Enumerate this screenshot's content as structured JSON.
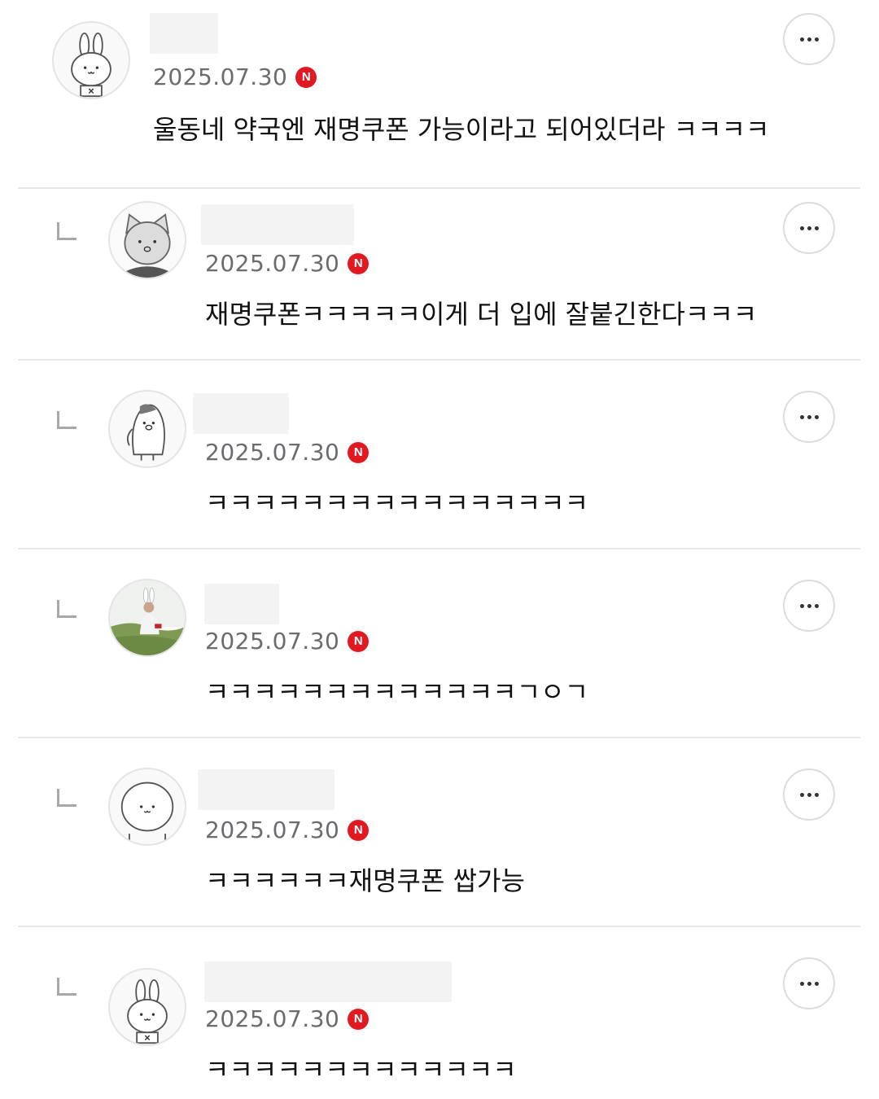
{
  "comments": [
    {
      "date": "2025.07.30",
      "badge": "N",
      "text": "울동네 약국엔 재명쿠폰 가능이라고 되어있더라 ㅋㅋㅋㅋ",
      "avatar_icon": "rabbit-avatar-icon"
    },
    {
      "date": "2025.07.30",
      "badge": "N",
      "text": "재명쿠폰ㅋㅋㅋㅋㅋ이게 더 입에 잘붙긴한다ㅋㅋㅋ",
      "avatar_icon": "cat-avatar-icon"
    },
    {
      "date": "2025.07.30",
      "badge": "N",
      "text": "ㅋㅋㅋㅋㅋㅋㅋㅋㅋㅋㅋㅋㅋㅋㅋㅋ",
      "avatar_icon": "penguin-avatar-icon"
    },
    {
      "date": "2025.07.30",
      "badge": "N",
      "text": "ㅋㅋㅋㅋㅋㅋㅋㅋㅋㅋㅋㅋㅋㄱㅇㄱ",
      "avatar_icon": "photo-avatar-icon"
    },
    {
      "date": "2025.07.30",
      "badge": "N",
      "text": "ㅋㅋㅋㅋㅋㅋ재명쿠폰 쌉가능",
      "avatar_icon": "blob-avatar-icon"
    },
    {
      "date": "2025.07.30",
      "badge": "N",
      "text": "ㅋㅋㅋㅋㅋㅋㅋㅋㅋㅋㅋㅋㅋ",
      "avatar_icon": "rabbit-avatar-icon"
    }
  ],
  "more_icon": "more-dots-icon",
  "reply_icon": "reply-arrow-icon",
  "colors": {
    "badge": "#e11a22",
    "date": "#6b6b70",
    "divider": "#e6e6e6"
  }
}
